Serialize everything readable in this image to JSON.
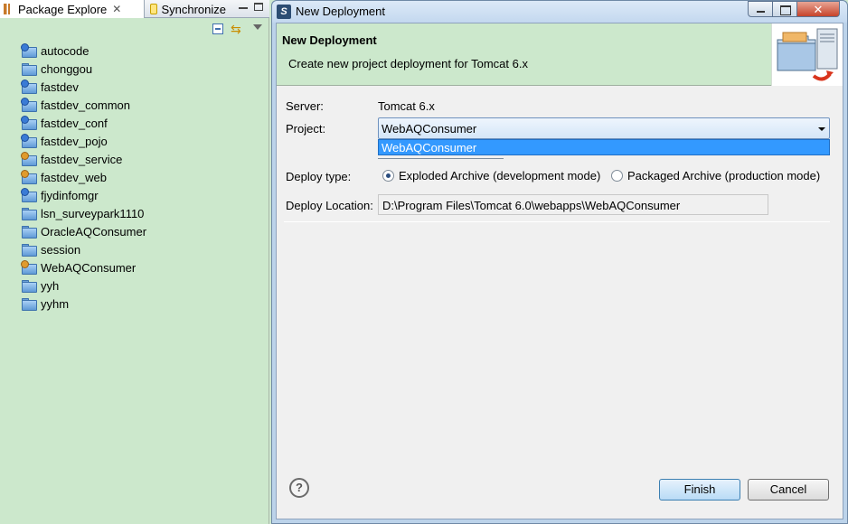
{
  "package_view": {
    "tabs": [
      {
        "label": "Package Explore",
        "icon": "package-explorer-icon"
      },
      {
        "label": "Synchronize",
        "icon": "synchronize-icon"
      }
    ],
    "close_glyph": "✕",
    "link_glyph": "⇆",
    "projects": [
      {
        "name": "autocode",
        "icon": "web-project-icon"
      },
      {
        "name": "chonggou",
        "icon": "folder-icon"
      },
      {
        "name": "fastdev",
        "icon": "web-project-icon"
      },
      {
        "name": "fastdev_common",
        "icon": "web-project-icon"
      },
      {
        "name": "fastdev_conf",
        "icon": "web-project-icon"
      },
      {
        "name": "fastdev_pojo",
        "icon": "web-project-icon"
      },
      {
        "name": "fastdev_service",
        "icon": "java-project-icon"
      },
      {
        "name": "fastdev_web",
        "icon": "java-project-icon"
      },
      {
        "name": "fjydinfomgr",
        "icon": "web-project-icon"
      },
      {
        "name": "lsn_surveypark1110",
        "icon": "folder-icon"
      },
      {
        "name": "OracleAQConsumer",
        "icon": "folder-icon"
      },
      {
        "name": "session",
        "icon": "folder-icon"
      },
      {
        "name": "WebAQConsumer",
        "icon": "java-project-icon"
      },
      {
        "name": "yyh",
        "icon": "folder-icon"
      },
      {
        "name": "yyhm",
        "icon": "folder-icon"
      }
    ]
  },
  "dialog": {
    "window_title": "New Deployment",
    "icon_glyph": "S",
    "close_glyph": "✕",
    "banner": {
      "title": "New Deployment",
      "description": "Create new project deployment for Tomcat  6.x"
    },
    "server": {
      "label": "Server:",
      "value": "Tomcat  6.x"
    },
    "project": {
      "label": "Project:",
      "selected": "WebAQConsumer",
      "options": [
        "WebAQConsumer"
      ]
    },
    "deploy_type": {
      "label": "Deploy type:",
      "options": [
        {
          "label": "Exploded Archive (development mode)",
          "checked": true
        },
        {
          "label": "Packaged Archive (production mode)",
          "checked": false
        }
      ]
    },
    "deploy_location": {
      "label": "Deploy Location:",
      "value": "D:\\Program Files\\Tomcat 6.0\\webapps\\WebAQConsumer"
    },
    "help_glyph": "?",
    "buttons": {
      "finish": "Finish",
      "cancel": "Cancel"
    }
  },
  "colors": {
    "banner_background": "#cce8cc",
    "selection": "#3399ff",
    "title_bar": "#c3d8ef",
    "close_button": "#c7432a"
  }
}
